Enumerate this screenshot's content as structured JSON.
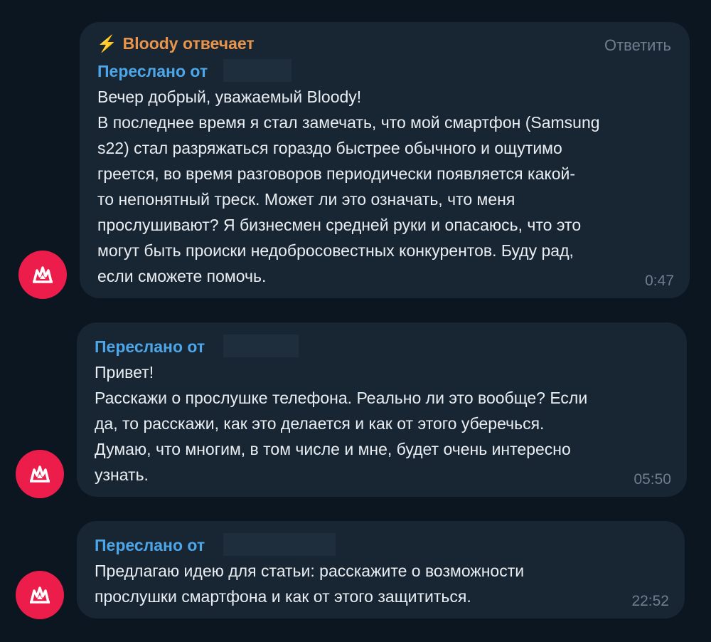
{
  "messages": [
    {
      "sender": "Bloody отвечает",
      "sender_icon": "lightning-icon",
      "reply_label": "Ответить",
      "forwarded_label": "Переслано от",
      "lines": [
        "Вечер добрый, уважаемый Bloody!",
        "В последнее время я стал замечать, что мой смартфон (Samsung",
        "s22) стал разряжаться гораздо быстрее обычного и ощутимо",
        "греется, во время разговоров периодически появляется какой-",
        "то непонятный треск. Может ли это означать, что меня",
        "прослушивают? Я бизнесмен средней руки и опасаюсь, что это",
        "могут быть происки недобросовестных конкурентов. Буду рад,",
        "если сможете помочь."
      ],
      "time": "0:47"
    },
    {
      "forwarded_label": "Переслано от",
      "lines": [
        "Привет!",
        "Расскажи о прослушке телефона. Реально ли это вообще? Если",
        "да, то расскажи, как это делается и как от этого уберечься.",
        "Думаю, что многим, в том числе и мне, будет очень интересно",
        "узнать."
      ],
      "time": "05:50"
    },
    {
      "forwarded_label": "Переслано от",
      "lines": [
        "Предлагаю идею для статьи: расскажите о возможности",
        "прослушки смартфона и как от этого защититься."
      ],
      "time": "22:52"
    }
  ],
  "colors": {
    "background": "#0c1621",
    "bubble": "#182533",
    "avatar": "#ec1d4b",
    "sender": "#e8954b",
    "forwarded": "#4ca6e8",
    "text": "#e9eef3",
    "muted": "#6d7f8f"
  }
}
